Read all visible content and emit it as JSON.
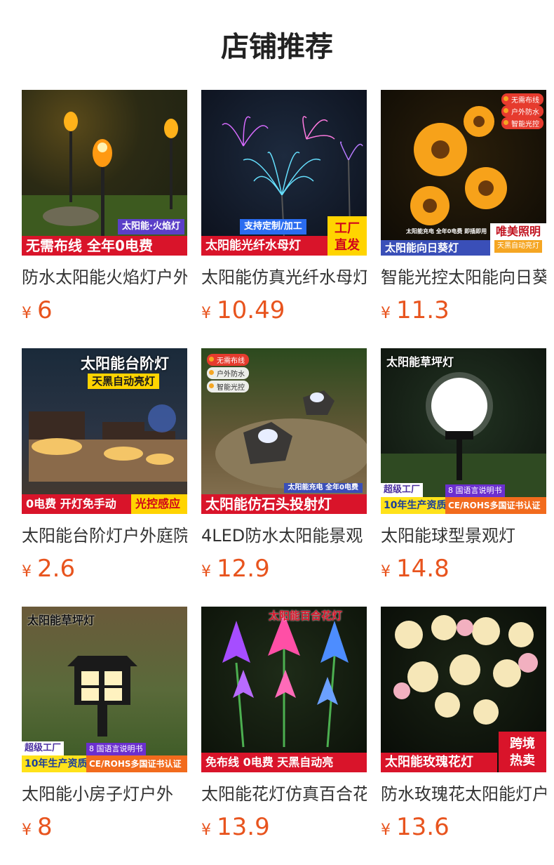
{
  "page": {
    "title": "店铺推荐"
  },
  "colors": {
    "price": "#e8541e",
    "banner_red": "#d9142a",
    "banner_blue": "#3a4fb8",
    "yellow": "#ffd400"
  },
  "products": [
    {
      "name": "防水太阳能火焰灯户外",
      "currency": "¥",
      "price": "6",
      "image": {
        "tag": "太阳能·火焰灯",
        "banner": "无需布线 全年0电费"
      }
    },
    {
      "name": "太阳能仿真光纤水母灯",
      "currency": "¥",
      "price": "10.49",
      "image": {
        "tag": "支持定制/加工",
        "banner": "太阳能光纤水母灯",
        "corner": "工厂直发"
      }
    },
    {
      "name": "智能光控太阳能向日葵",
      "currency": "¥",
      "price": "11.3",
      "image": {
        "pills": [
          "无需布线",
          "户外防水",
          "智能光控"
        ],
        "note": "太阳能充电 全年0电费 即插即用",
        "banner": "太阳能向日葵灯",
        "corner_title": "唯美照明",
        "corner_sub": "天黑自动亮灯"
      }
    },
    {
      "name": "太阳能台阶灯户外庭院",
      "currency": "¥",
      "price": "2.6",
      "image": {
        "title": "太阳能台阶灯",
        "subtitle": "天黑自动亮灯",
        "banner": "0电费 开灯免手动",
        "banner_right": "光控感应"
      }
    },
    {
      "name": "4LED防水太阳能景观",
      "currency": "¥",
      "price": "12.9",
      "image": {
        "pills": [
          "无需布线",
          "户外防水",
          "智能光控"
        ],
        "note": "太阳能充电 全年0电费",
        "banner": "太阳能仿石头投射灯"
      }
    },
    {
      "name": "太阳能球型景观灯",
      "currency": "¥",
      "price": "14.8",
      "image": {
        "title": "太阳能草坪灯",
        "cert_factory": "超级工厂",
        "cert_years": "10年生产资质",
        "cert_lang": "8 国语言说明书",
        "cert_ce": "CE/ROHS多国证书认证"
      }
    },
    {
      "name": "太阳能小房子灯户外",
      "currency": "¥",
      "price": "8",
      "image": {
        "title": "太阳能草坪灯",
        "cert_factory": "超级工厂",
        "cert_years": "10年生产资质",
        "cert_lang": "8 国语言说明书",
        "cert_ce": "CE/ROHS多国证书认证"
      }
    },
    {
      "name": "太阳能花灯仿真百合花",
      "currency": "¥",
      "price": "13.9",
      "image": {
        "title": "太阳能百合花灯",
        "banner": "免布线 0电费 天黑自动亮"
      }
    },
    {
      "name": "防水玫瑰花太阳能灯户",
      "currency": "¥",
      "price": "13.6",
      "image": {
        "banner": "太阳能玫瑰花灯",
        "corner": "跨境热卖"
      }
    }
  ]
}
